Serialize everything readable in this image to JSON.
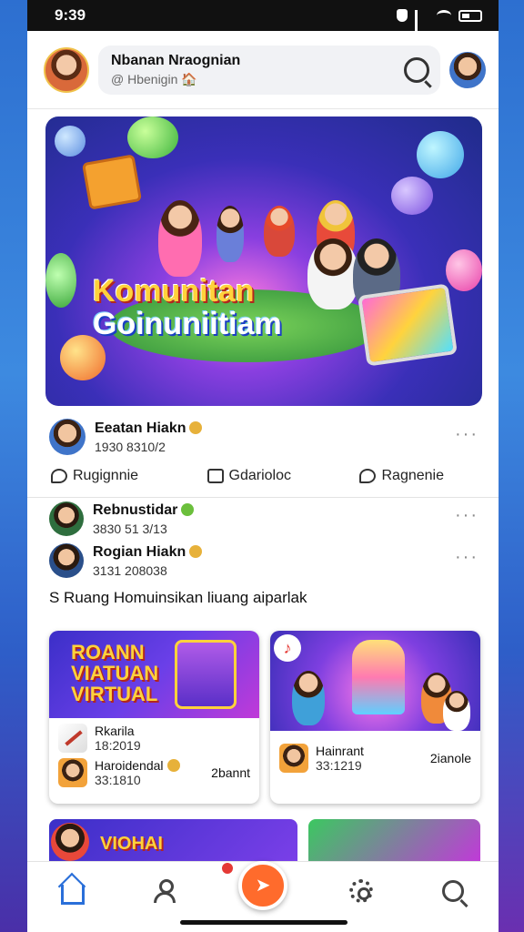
{
  "status_bar": {
    "time": "9:39"
  },
  "header": {
    "title": "Nbanan Nraognian",
    "subtitle": "@ Hbenigin 🏠"
  },
  "hero": {
    "title_line1": "Komunitan",
    "title_line2": "Goinuniitiam"
  },
  "posts": [
    {
      "author": "Eeatan Hiakn",
      "meta": "1930 8310/2",
      "verified": true,
      "badge_color": "#e7b13a"
    },
    {
      "author": "Rebnustidar",
      "meta": "3830 51 3/13",
      "verified": true,
      "badge_color": "#6bbf3c"
    },
    {
      "author": "Rogian Hiakn",
      "meta": "3131 208038",
      "verified": true,
      "badge_color": "#e7b13a"
    }
  ],
  "actions": [
    {
      "label": "Rugignnie",
      "icon": "like-icon"
    },
    {
      "label": "Gdarioloc",
      "icon": "comment-icon"
    },
    {
      "label": "Ragnenie",
      "icon": "share-icon"
    }
  ],
  "feed_text": "S Ruang Homuinsikan liuang aiparlak",
  "cards": [
    {
      "image_title_line1": "ROANN",
      "image_title_line2": "VIATUAN",
      "image_title_line3": "VIRTUAL",
      "rows": [
        {
          "title": "Rkarila",
          "time": "18:2019",
          "right": ""
        },
        {
          "title": "Haroidendal",
          "time": "33:1810",
          "right": "2bannt"
        }
      ]
    },
    {
      "rows": [
        {
          "title": "Hainrant",
          "time": "33:1219",
          "right": "2ianole"
        }
      ]
    }
  ],
  "peek": {
    "title": "VIOHAI"
  },
  "tabbar": [
    "home-icon",
    "profile-icon",
    "play-icon",
    "settings-icon",
    "search-icon"
  ]
}
